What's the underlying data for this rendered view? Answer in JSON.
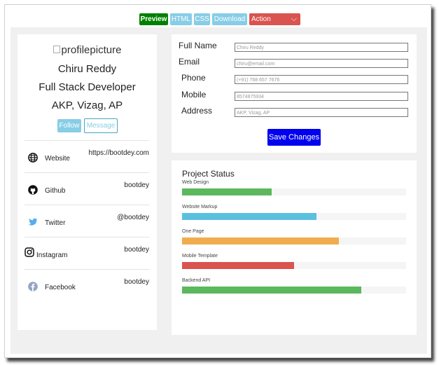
{
  "toolbar": {
    "preview": "Preview",
    "html": "HTML",
    "css": "CSS",
    "download": "Download",
    "action": "Action"
  },
  "profile": {
    "picture_alt": "profilepicture",
    "name": "Chiru Reddy",
    "role": "Full Stack Developer",
    "location": "AKP, Vizag, AP",
    "follow_label": "Follow",
    "message_label": "Message"
  },
  "links": [
    {
      "label": "Website",
      "value": "https://bootdey.com",
      "icon": "globe-icon"
    },
    {
      "label": "Github",
      "value": "bootdey",
      "icon": "github-icon"
    },
    {
      "label": "Twitter",
      "value": "@bootdey",
      "icon": "twitter-icon"
    },
    {
      "label": "Instagram",
      "value": "bootdey",
      "icon": "instagram-icon"
    },
    {
      "label": "Facebook",
      "value": "bootdey",
      "icon": "facebook-icon"
    }
  ],
  "form": {
    "fields": [
      {
        "label": "Full Name",
        "placeholder": "Chiru Reddy"
      },
      {
        "label": "Email",
        "placeholder": "chiru@email.com"
      },
      {
        "label": "Phone",
        "placeholder": "(+91) 768 657 7676"
      },
      {
        "label": "Mobile",
        "placeholder": "8574875934"
      },
      {
        "label": "Address",
        "placeholder": "AKP, Vizag, AP"
      }
    ],
    "save_label": "Save Changes"
  },
  "project_status": {
    "title": "Project Status",
    "items": [
      {
        "label": "Web Design",
        "percent": 40,
        "color": "#5cb85c"
      },
      {
        "label": "Website Markup",
        "percent": 60,
        "color": "#5bc0de"
      },
      {
        "label": "One Page",
        "percent": 70,
        "color": "#f0ad4e"
      },
      {
        "label": "Mobile Template",
        "percent": 50,
        "color": "#d9534f"
      },
      {
        "label": "Backend API",
        "percent": 80,
        "color": "#5cb85c"
      }
    ]
  },
  "colors": {
    "preview_green": "#008000",
    "light_blue": "#87cde6",
    "action_red": "#d9534f",
    "save_blue": "#0000ee"
  }
}
